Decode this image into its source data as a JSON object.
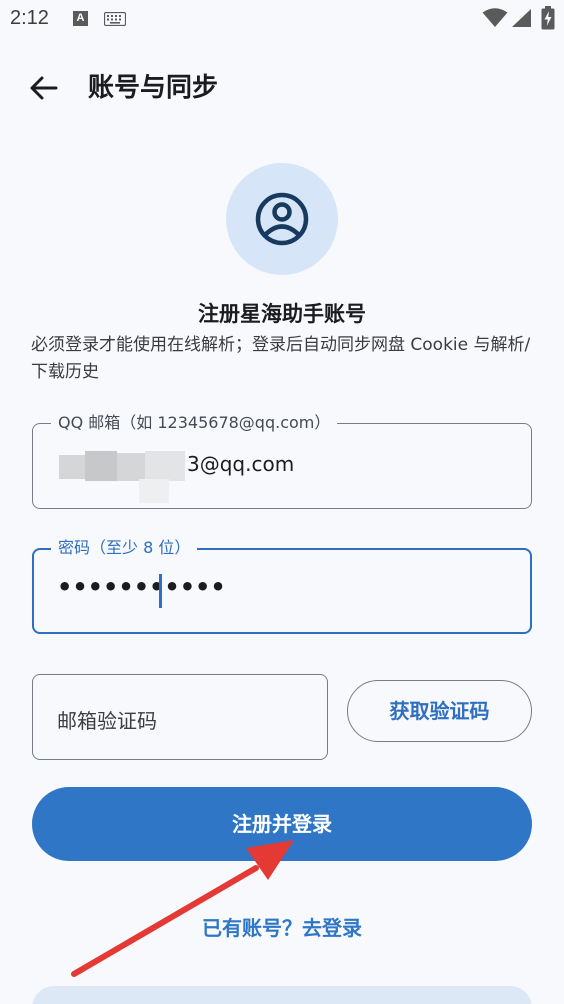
{
  "status_bar": {
    "time": "2:12",
    "notification_icon_letter": "A"
  },
  "header": {
    "title": "账号与同步"
  },
  "profile": {
    "icon": "account-circle-icon",
    "heading": "注册星海助手账号",
    "description": "必须登录才能使用在线解析；登录后自动同步网盘 Cookie 与解析/下载历史"
  },
  "form": {
    "email": {
      "label": "QQ 邮箱（如 12345678@qq.com）",
      "value_visible_suffix": "3@qq.com"
    },
    "password": {
      "label": "密码（至少 8 位）",
      "masked_value": "•••••••••••",
      "focused": true
    },
    "verification_code": {
      "placeholder": "邮箱验证码"
    },
    "get_code_button": "获取验证码",
    "submit_button": "注册并登录",
    "login_link": "已有账号？去登录"
  },
  "colors": {
    "background": "#f7f9fd",
    "accent": "#2f77c6",
    "avatar_bg": "#d6e6f8",
    "annotation_arrow": "#e53935"
  }
}
